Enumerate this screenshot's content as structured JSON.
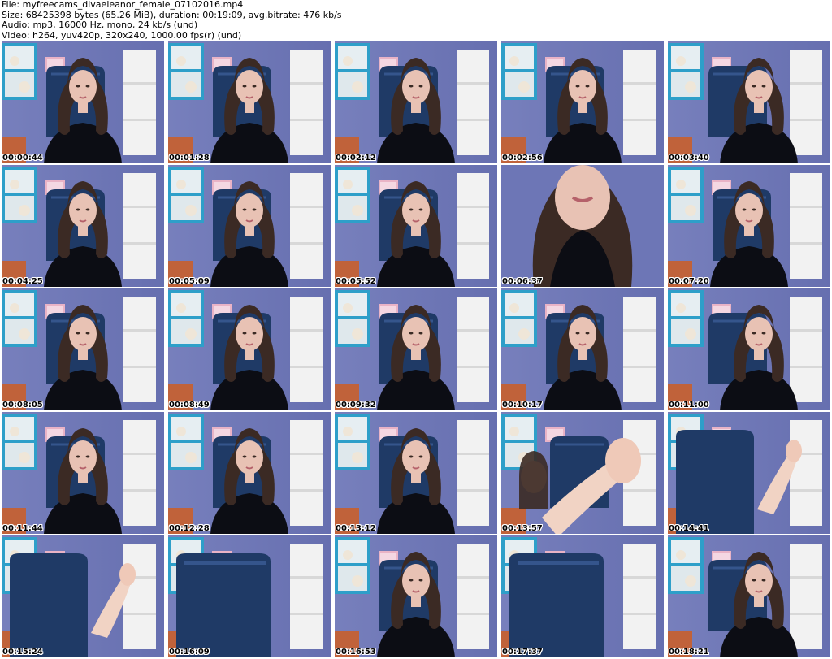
{
  "header": {
    "file": "File: myfreecams_divaeleanor_female_07102016.mp4",
    "size": "Size: 68425398 bytes (65.26 MiB), duration: 00:19:09, avg.bitrate: 476 kb/s",
    "audio": "Audio: mp3, 16000 Hz, mono, 24 kb/s (und)",
    "video": "Video: h264, yuv420p, 320x240, 1000.00 fps(r) (und)"
  },
  "thumbnails": [
    {
      "timestamp": "00:00:44",
      "scene": "portrait"
    },
    {
      "timestamp": "00:01:28",
      "scene": "portrait"
    },
    {
      "timestamp": "00:02:12",
      "scene": "portrait"
    },
    {
      "timestamp": "00:02:56",
      "scene": "portrait"
    },
    {
      "timestamp": "00:03:40",
      "scene": "portrait-right"
    },
    {
      "timestamp": "00:04:25",
      "scene": "portrait"
    },
    {
      "timestamp": "00:05:09",
      "scene": "portrait"
    },
    {
      "timestamp": "00:05:52",
      "scene": "portrait"
    },
    {
      "timestamp": "00:06:37",
      "scene": "closeup"
    },
    {
      "timestamp": "00:07:20",
      "scene": "portrait"
    },
    {
      "timestamp": "00:08:05",
      "scene": "portrait"
    },
    {
      "timestamp": "00:08:49",
      "scene": "portrait"
    },
    {
      "timestamp": "00:09:32",
      "scene": "portrait"
    },
    {
      "timestamp": "00:10:17",
      "scene": "portrait"
    },
    {
      "timestamp": "00:11:00",
      "scene": "portrait-right"
    },
    {
      "timestamp": "00:11:44",
      "scene": "portrait"
    },
    {
      "timestamp": "00:12:28",
      "scene": "portrait"
    },
    {
      "timestamp": "00:13:12",
      "scene": "portrait"
    },
    {
      "timestamp": "00:13:57",
      "scene": "legs"
    },
    {
      "timestamp": "00:14:41",
      "scene": "chair-legs"
    },
    {
      "timestamp": "00:15:24",
      "scene": "chair-legs"
    },
    {
      "timestamp": "00:16:09",
      "scene": "chair"
    },
    {
      "timestamp": "00:16:53",
      "scene": "portrait"
    },
    {
      "timestamp": "00:17:37",
      "scene": "chair"
    },
    {
      "timestamp": "00:18:21",
      "scene": "portrait-right"
    }
  ],
  "colors": {
    "wall": "#6d76b6",
    "shelf": "#2e9fc9",
    "chair": "#1f3a66",
    "hair": "#3b2a24",
    "skin": "#e8c2b4",
    "top": "#0c0d14",
    "bookcase": "#f2f2f2"
  }
}
